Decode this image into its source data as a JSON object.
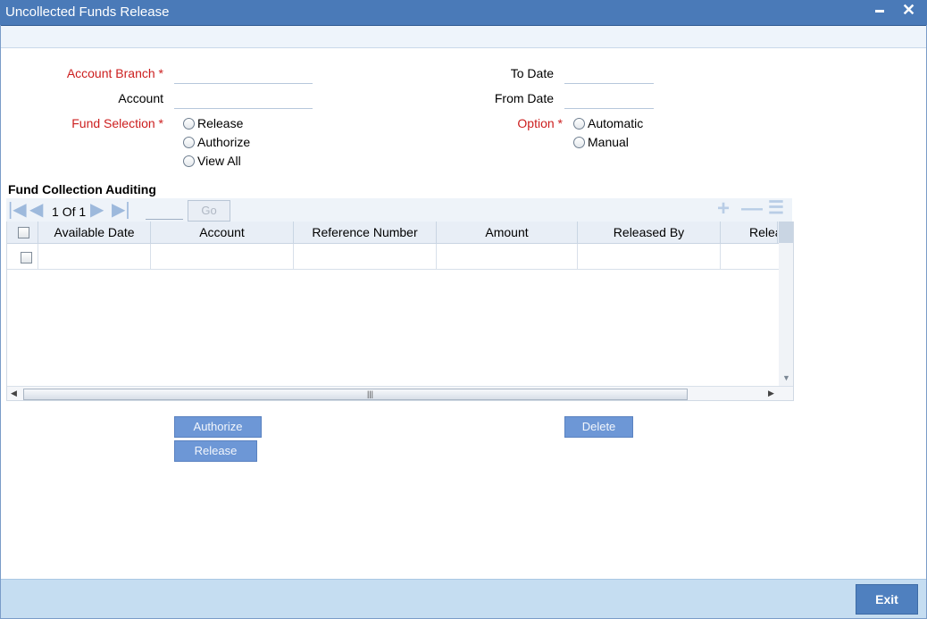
{
  "window": {
    "title": "Uncollected Funds Release",
    "minimize": "",
    "close": "✕"
  },
  "form": {
    "account_branch": {
      "label": "Account Branch",
      "required": "*",
      "value": ""
    },
    "account": {
      "label": "Account",
      "value": ""
    },
    "fund_selection": {
      "label": "Fund Selection",
      "required": "*",
      "options": [
        "Release",
        "Authorize",
        "View All"
      ]
    },
    "to_date": {
      "label": "To Date",
      "value": ""
    },
    "from_date": {
      "label": "From Date",
      "value": ""
    },
    "option": {
      "label": "Option",
      "required": "*",
      "options": [
        "Automatic",
        "Manual"
      ]
    }
  },
  "grid": {
    "section_title": "Fund Collection Auditing",
    "pager": {
      "current": "1",
      "of_label": "Of",
      "total": "1",
      "page_input": ""
    },
    "go_label": "Go",
    "columns": [
      "Available Date",
      "Account",
      "Reference Number",
      "Amount",
      "Released By",
      "Relea"
    ]
  },
  "buttons": {
    "authorize": "Authorize",
    "release": "Release",
    "delete": "Delete",
    "exit": "Exit"
  },
  "colors": {
    "titlebar": "#4a7ab8",
    "required_label": "#cc1e1e",
    "action_button": "#6d97d6",
    "footer": "#c5ddf1"
  },
  "icons": {
    "first_page": "first-page-icon",
    "prev_page": "prev-page-icon",
    "next_page": "next-page-icon",
    "last_page": "last-page-icon",
    "add_row": "add-row-icon",
    "delete_row": "delete-row-icon",
    "view_rows": "list-view-icon"
  }
}
